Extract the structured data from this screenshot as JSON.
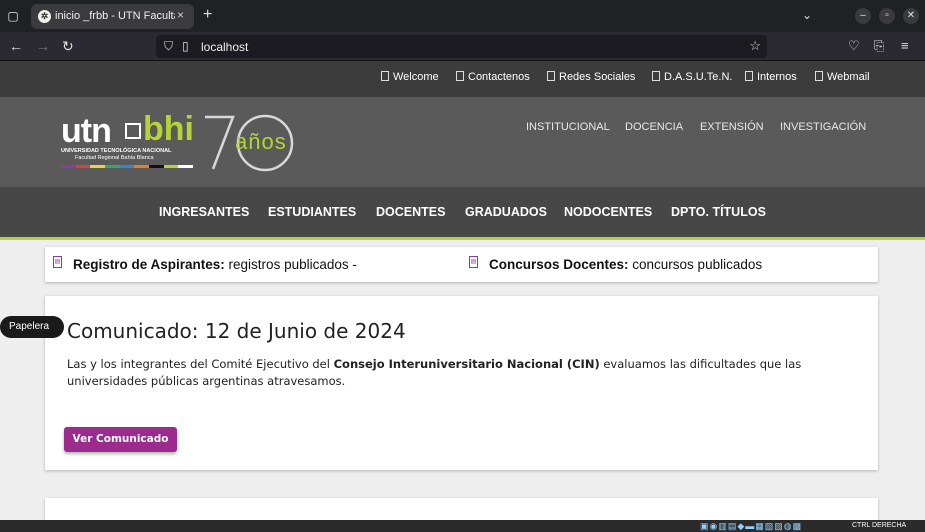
{
  "browser": {
    "tab_title": "inicio _frbb - UTN Faculta",
    "url": "localhost",
    "new_tab": "+",
    "tab_close": "×"
  },
  "topbar": {
    "links": [
      "Welcome",
      "Contactenos",
      "Redes Sociales",
      "D.A.S.U.Te.N.",
      "Internos",
      "Webmail"
    ]
  },
  "logo": {
    "utn": "utn",
    "bhi": "bhi",
    "line1": "UNIVERSIDAD TECNOLÓGICA NACIONAL",
    "line2": "Facultad Regional Bahía Blanca",
    "anos": "años"
  },
  "header_nav": [
    "INSTITUCIONAL",
    "DOCENCIA",
    "EXTENSIÓN",
    "INVESTIGACIÓN"
  ],
  "main_nav": [
    "INGRESANTES",
    "ESTUDIANTES",
    "DOCENTES",
    "GRADUADOS",
    "NODOCENTES",
    "DPTO. TÍTULOS"
  ],
  "ticker": [
    {
      "label": "Registro de Aspirantes:",
      "text": " registros publicados -"
    },
    {
      "label": "Concursos Docentes:",
      "text": " concursos publicados"
    }
  ],
  "announcement": {
    "title": "Comunicado: 12 de Junio de 2024",
    "body_pre": "Las y los integrantes del Comité Ejecutivo del ",
    "body_bold": "Consejo Interuniversitario Nacional (CIN)",
    "body_post": " evaluamos las dificultades que las universidades públicas argentinas atravesamos.",
    "button": "Ver Comunicado"
  },
  "papelera": "Papelera",
  "vm_status": "CTRL DERECHA",
  "colors": {
    "accent_green": "#b5d334",
    "accent_purple": "#9b2c8e",
    "header_gray": "#5a5a5a"
  }
}
